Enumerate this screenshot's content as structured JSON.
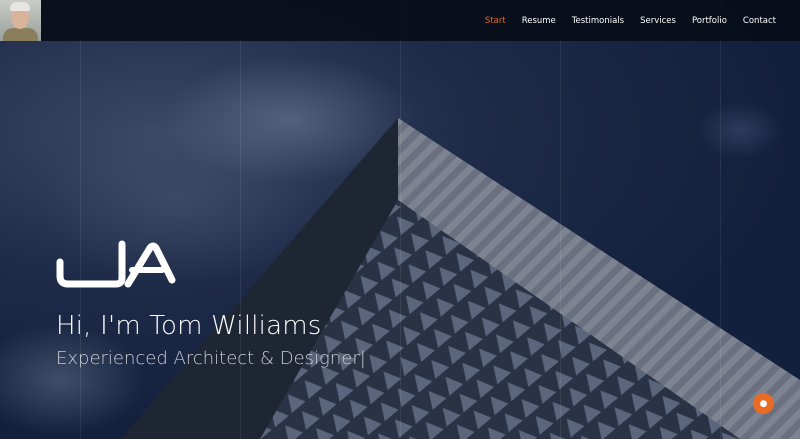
{
  "nav": {
    "items": [
      {
        "label": "Start",
        "active": true
      },
      {
        "label": "Resume"
      },
      {
        "label": "Testimonials"
      },
      {
        "label": "Services"
      },
      {
        "label": "Portfolio"
      },
      {
        "label": "Contact"
      }
    ]
  },
  "hero": {
    "logo": "JA",
    "title": "Hi, I'm Tom Williams",
    "subtitle": "Experienced Architect & Designer|"
  },
  "colors": {
    "accent": "#e7672a",
    "chat": "#ea6b22"
  },
  "icons": {
    "chat": "chat-bubble-icon"
  }
}
